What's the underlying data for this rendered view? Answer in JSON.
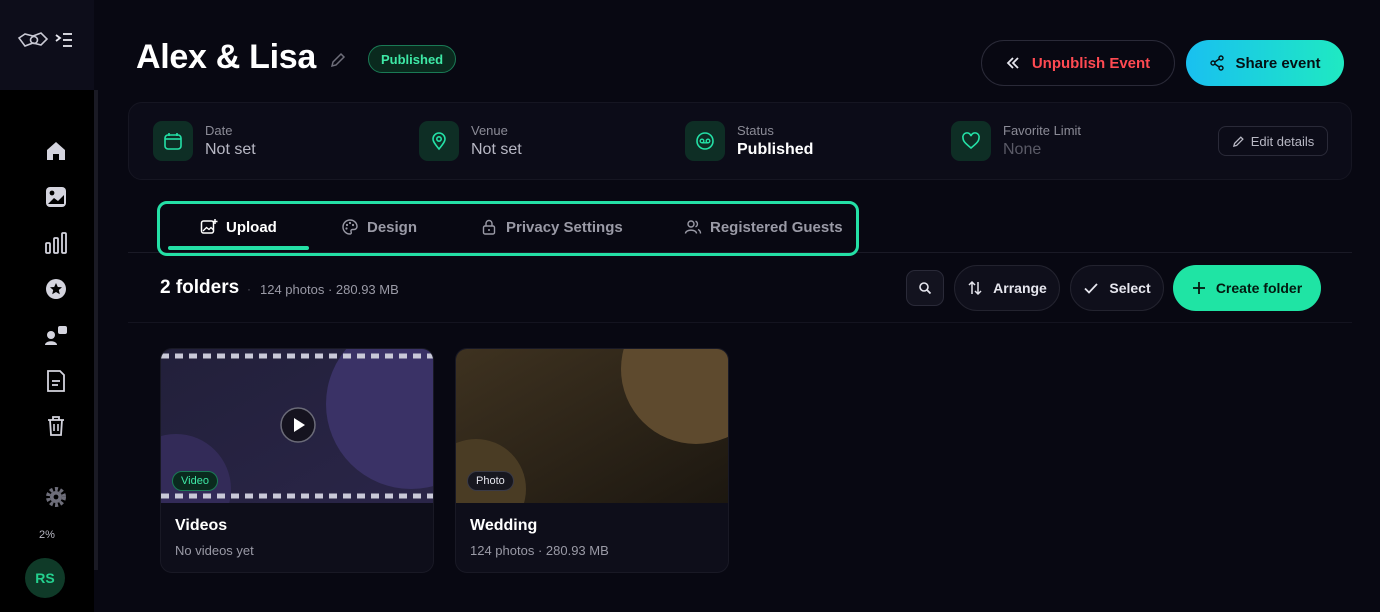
{
  "event": {
    "title": "Alex & Lisa",
    "status_badge": "Published",
    "unpublish_label": "Unpublish Event",
    "share_label": "Share event"
  },
  "info": {
    "date": {
      "label": "Date",
      "value": "Not set"
    },
    "venue": {
      "label": "Venue",
      "value": "Not set"
    },
    "status": {
      "label": "Status",
      "value": "Published"
    },
    "favorite_limit": {
      "label": "Favorite Limit",
      "value": "None"
    },
    "edit_label": "Edit details"
  },
  "tabs": [
    {
      "label": "Upload",
      "icon": "image-plus-icon",
      "active": true
    },
    {
      "label": "Design",
      "icon": "palette-icon"
    },
    {
      "label": "Privacy Settings",
      "icon": "lock-icon"
    },
    {
      "label": "Registered Guests",
      "icon": "users-icon"
    }
  ],
  "folders_toolbar": {
    "count_label": "2 folders",
    "separator": "·",
    "meta": "124 photos · 280.93 MB",
    "arrange_label": "Arrange",
    "select_label": "Select",
    "create_label": "Create folder"
  },
  "folders": [
    {
      "name": "Videos",
      "subtitle": "No videos yet",
      "badge": "Video"
    },
    {
      "name": "Wedding",
      "subtitle": "124 photos · 280.93 MB",
      "badge": "Photo"
    }
  ],
  "sidebar": {
    "storage": "2%",
    "avatar_initials": "RS",
    "nav": [
      "home-icon",
      "gallery-icon",
      "analytics-icon",
      "favorites-icon",
      "clients-icon",
      "documents-icon",
      "trash-icon",
      "settings-icon"
    ]
  },
  "colors": {
    "accent": "#24e0a6",
    "danger": "#ff4a52",
    "background": "#080812"
  }
}
